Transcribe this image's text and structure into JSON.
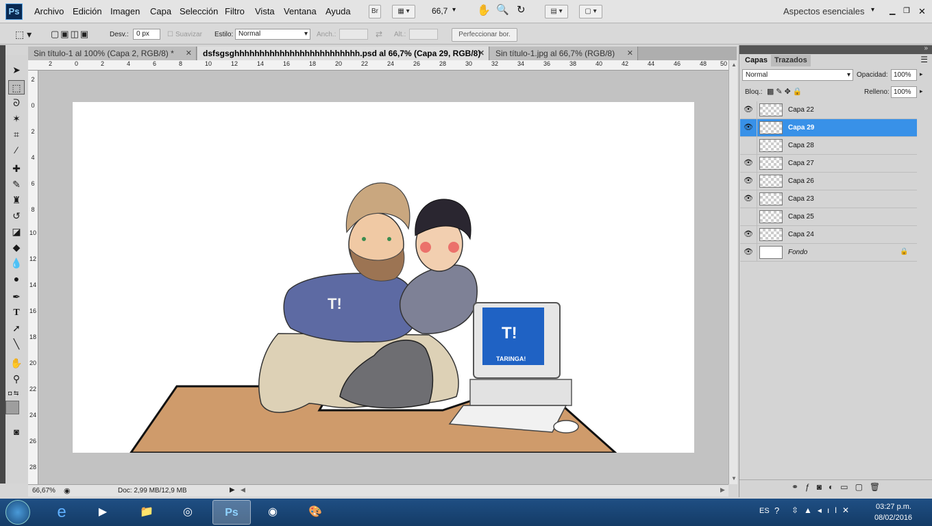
{
  "app": {
    "logo": "Ps",
    "menu": [
      "Archivo",
      "Edición",
      "Imagen",
      "Capa",
      "Selección",
      "Filtro",
      "Vista",
      "Ventana",
      "Ayuda"
    ],
    "bridge_btn": "Br",
    "zoom_select": "66,7",
    "workspace": "Aspectos esenciales"
  },
  "options": {
    "feather_label": "Desv.:",
    "feather_value": "0 px",
    "smooth_label": "Suavizar",
    "style_label": "Estilo:",
    "style_value": "Normal",
    "width_label": "Anch.:",
    "height_label": "Alt.:",
    "refine_button": "Perfeccionar bor."
  },
  "tabs": [
    {
      "label": "Sin título-1 al 100% (Capa 2, RGB/8) *"
    },
    {
      "label": "dsfsgsghhhhhhhhhhhhhhhhhhhhhhhhh.psd al 66,7% (Capa 29, RGB/8)"
    },
    {
      "label": "Sin título-1.jpg al 66,7% (RGB/8)"
    }
  ],
  "ruler": {
    "top": [
      "2",
      "0",
      "2",
      "4",
      "6",
      "8",
      "10",
      "12",
      "14",
      "16",
      "18",
      "20",
      "22",
      "24",
      "26",
      "28",
      "30",
      "32",
      "34",
      "36",
      "38",
      "40",
      "42",
      "44",
      "46",
      "48",
      "50"
    ],
    "left": [
      "2",
      "0",
      "2",
      "4",
      "6",
      "8",
      "10",
      "12",
      "14",
      "16",
      "18",
      "20",
      "22",
      "24",
      "26",
      "28"
    ]
  },
  "canvas_art": {
    "shirt_text": "T!",
    "screen_logo": "T!",
    "screen_text": "TARINGA!"
  },
  "status": {
    "zoom": "66,67%",
    "doc": "Doc: 2,99 MB/12,9 MB"
  },
  "layers_panel": {
    "tab_layers": "Capas",
    "tab_paths": "Trazados",
    "blend_mode": "Normal",
    "opacity_label": "Opacidad:",
    "opacity_value": "100%",
    "lock_label": "Bloq.:",
    "fill_label": "Relleno:",
    "fill_value": "100%",
    "layers": [
      {
        "name": "Capa 22",
        "visible": true
      },
      {
        "name": "Capa 29",
        "visible": true,
        "selected": true
      },
      {
        "name": "Capa 28",
        "visible": false
      },
      {
        "name": "Capa 27",
        "visible": true
      },
      {
        "name": "Capa 26",
        "visible": true
      },
      {
        "name": "Capa 23",
        "visible": true
      },
      {
        "name": "Capa 25",
        "visible": false
      },
      {
        "name": "Capa 24",
        "visible": true
      },
      {
        "name": "Fondo",
        "visible": true,
        "locked": true
      }
    ]
  },
  "taskbar": {
    "lang": "ES",
    "time": "03:27 p.m.",
    "date": "08/02/2016"
  },
  "colors": {
    "selection": "#3891e8",
    "desk": "#cf9b6b",
    "shirt": "#5d6aa3",
    "taskbar": "#1a4575"
  }
}
